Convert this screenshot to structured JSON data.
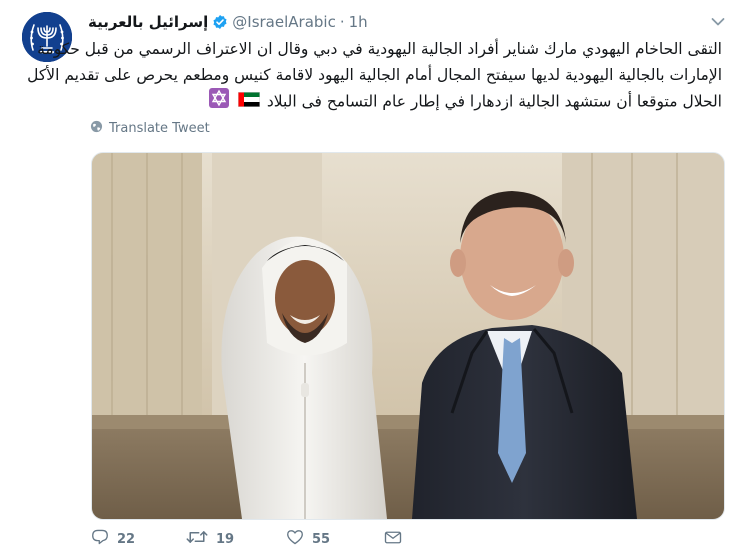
{
  "tweet": {
    "display_name": "إسرائيل بالعربية",
    "handle": "@IsraelArabic",
    "separator": "·",
    "time": "1h",
    "text_lines": [
      "التقى الحاخام اليهودي مارك شناير أفراد الجالية اليهودية في دبي وقال ان الاعتراف الرسمي من قبل حكومة",
      "الإمارات بالجالية اليهودية لديها سيفتح المجال أمام الجالية اليهود لاقامة كنيس ومطعم يحرص على تقديم الأكل",
      "الحلال متوقعا أن ستشهد الجالية ازدهارا في إطار عام التسامح فى البلاد"
    ],
    "translate_label": "Translate Tweet",
    "actions": {
      "reply_count": "22",
      "retweet_count": "19",
      "like_count": "55"
    }
  },
  "icons": {
    "avatar": "israel-emblem",
    "verified": "verified-badge-icon",
    "caret": "chevron-down-icon",
    "translate": "globe-icon",
    "reply": "reply-icon",
    "retweet": "retweet-icon",
    "like": "heart-icon",
    "dm": "envelope-icon",
    "flag": "uae-flag-emoji",
    "star": "star-of-david-emoji"
  },
  "colors": {
    "accent": "#1da1f2",
    "muted": "#657786",
    "text": "#14171a",
    "avatar_bg": "#12408f",
    "star_emoji_bg": "#9b59b6"
  }
}
